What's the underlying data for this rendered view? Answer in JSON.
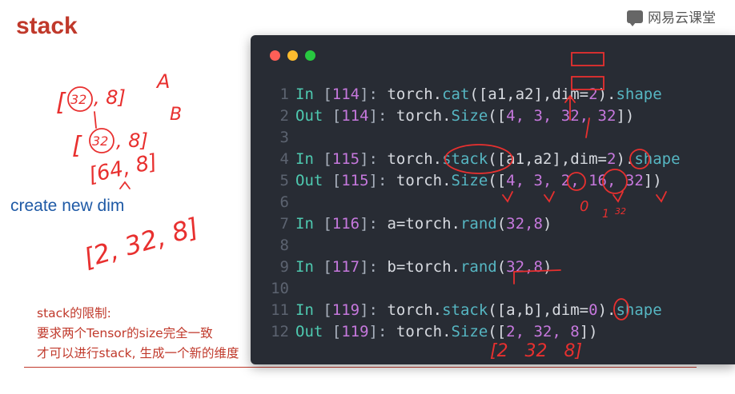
{
  "slide": {
    "title": "stack",
    "create_label": "create new dim",
    "notes": [
      "stack的限制:",
      "要求两个Tensor的size完全一致",
      "才可以进行stack, 生成一个新的维度"
    ]
  },
  "watermark": {
    "text": "网易云课堂"
  },
  "handwriting": {
    "a_shape_open": "[",
    "a_shape_n": "32",
    "a_shape_rest": ", 8]",
    "a_shape_label": "A",
    "b_shape_open": "[",
    "b_shape_n": "32",
    "b_shape_rest": ", 8]",
    "b_shape_label": "B",
    "cat_result": "[64, 8]",
    "stack_result": "[2, 32, 8]",
    "dim_index_0": "0",
    "dim_index_1": "1",
    "dim_note_32": "32",
    "result_note": "[2   32   8]"
  },
  "terminal": {
    "lines": [
      {
        "n": "1",
        "prompt": "In",
        "num": "114",
        "tail_ident": "torch.",
        "func": "cat",
        "args": "([a1,a2],dim=",
        "argnum": "2",
        "close": ").",
        "attr": "shape"
      },
      {
        "n": "2",
        "prompt": "Out",
        "num": "114",
        "tail_ident": "torch.",
        "func": "Size",
        "args": "([",
        "argnum": "4, 3, 32, 32",
        "close": "])",
        "attr": ""
      },
      {
        "n": "3"
      },
      {
        "n": "4",
        "prompt": "In",
        "num": "115",
        "tail_ident": "torch.",
        "func": "stack",
        "args": "([a1,a2],dim=",
        "argnum": "2",
        "close": ").",
        "attr": "shape"
      },
      {
        "n": "5",
        "prompt": "Out",
        "num": "115",
        "tail_ident": "torch.",
        "func": "Size",
        "args": "([",
        "argnum": "4, 3, 2, 16, 32",
        "close": "])",
        "attr": ""
      },
      {
        "n": "6"
      },
      {
        "n": "7",
        "prompt": "In",
        "num": "116",
        "tail_ident": "a=torch.",
        "func": "rand",
        "args": "(",
        "argnum": "32,8",
        "close": ")",
        "attr": ""
      },
      {
        "n": "8"
      },
      {
        "n": "9",
        "prompt": "In",
        "num": "117",
        "tail_ident": "b=torch.",
        "func": "rand",
        "args": "(",
        "argnum": "32,8",
        "close": ")",
        "attr": ""
      },
      {
        "n": "10"
      },
      {
        "n": "11",
        "prompt": "In",
        "num": "119",
        "tail_ident": "torch.",
        "func": "stack",
        "args": "([a,b],dim=",
        "argnum": "0",
        "close": ").",
        "attr": "shape"
      },
      {
        "n": "12",
        "prompt": "Out",
        "num": "119",
        "tail_ident": "torch.",
        "func": "Size",
        "args": "([",
        "argnum": "2, 32, 8",
        "close": "])",
        "attr": ""
      }
    ]
  },
  "colors": {
    "title": "#c0392b",
    "ink": "#e8302f",
    "blue_label": "#1f5aa6",
    "terminal_bg": "#282c34"
  }
}
